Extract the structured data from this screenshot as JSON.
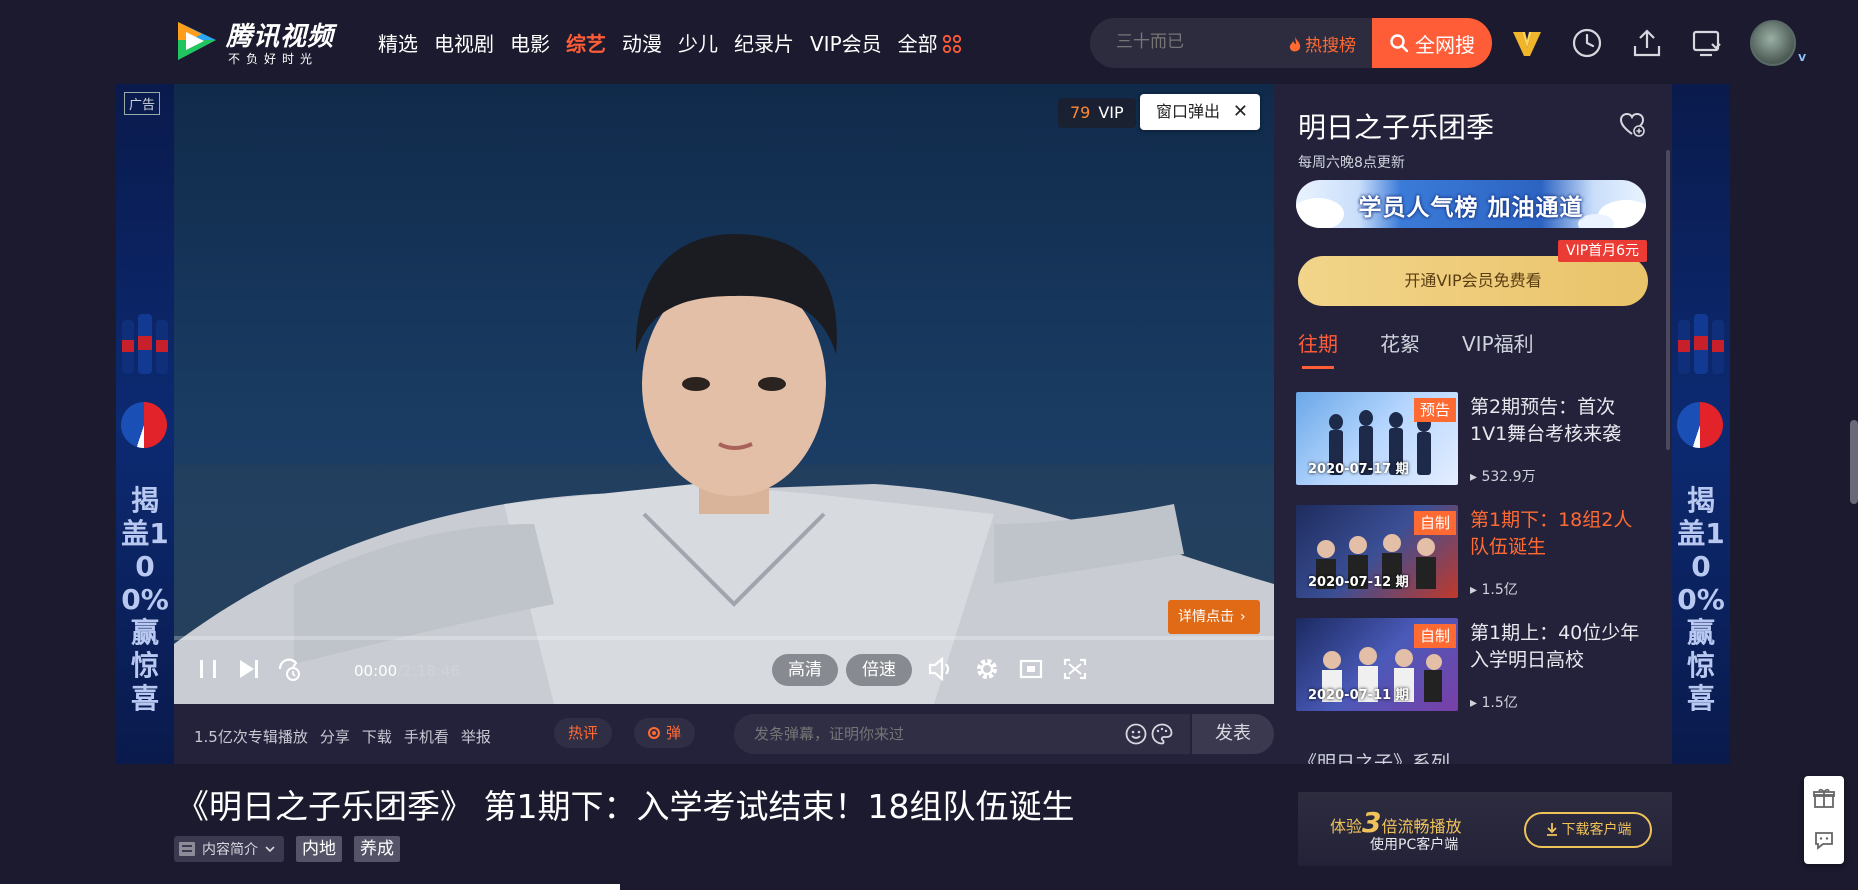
{
  "brand": {
    "name": "腾讯视频",
    "slogan": "不负好时光"
  },
  "nav": {
    "items": [
      {
        "label": "精选",
        "active": false
      },
      {
        "label": "电视剧",
        "active": false
      },
      {
        "label": "电影",
        "active": false
      },
      {
        "label": "综艺",
        "active": true
      },
      {
        "label": "动漫",
        "active": false
      },
      {
        "label": "少儿",
        "active": false
      },
      {
        "label": "纪录片",
        "active": false
      },
      {
        "label": "VIP会员",
        "active": false
      },
      {
        "label": "全部",
        "active": false
      }
    ]
  },
  "search": {
    "placeholder": "三十而已",
    "hot_rank_label": "热搜榜",
    "button_label": "全网搜"
  },
  "ad": {
    "tag": "广告",
    "slogan": "揭盖100%赢惊喜"
  },
  "player": {
    "vip_countdown": "79",
    "vip_label": "VIP",
    "popout_label": "窗口弹出",
    "detail_label": "详情点击",
    "current_time": "00:00",
    "total_time": "/2:18:46",
    "quality_label": "高清",
    "speed_label": "倍速",
    "progress": 0
  },
  "meta": {
    "play_count": "1.5亿次专辑播放",
    "share": "分享",
    "download": "下载",
    "mobile": "手机看",
    "report": "举报",
    "hot_comment": "热评",
    "danmu_label": "弹",
    "danmu_placeholder": "发条弹幕，证明你来过",
    "send_label": "发表"
  },
  "video": {
    "title": "《明日之子乐团季》 第1期下：入学考试结束！18组队伍诞生",
    "intro_label": "内容简介",
    "tags": [
      "内地",
      "养成"
    ]
  },
  "sidebar": {
    "title": "明日之子乐团季",
    "update_info": "每周六晚8点更新",
    "banner_text": "学员人气榜 加油通道",
    "vip_button": "开通VIP会员免费看",
    "vip_promo": "VIP首月6元",
    "tabs": [
      {
        "label": "往期",
        "active": true
      },
      {
        "label": "花絮",
        "active": false
      },
      {
        "label": "VIP福利",
        "active": false
      }
    ],
    "episodes": [
      {
        "title": "第2期预告：首次1V1舞台考核来袭",
        "date": "2020-07-17 期",
        "badge": "预告",
        "views": "532.9万",
        "current": false
      },
      {
        "title": "第1期下：18组2人队伍诞生",
        "date": "2020-07-12 期",
        "badge": "自制",
        "views": "1.5亿",
        "current": true
      },
      {
        "title": "第1期上：40位少年入学明日高校",
        "date": "2020-07-11 期",
        "badge": "自制",
        "views": "1.5亿",
        "current": false
      }
    ],
    "series_label": "《明日之子》系列"
  },
  "client_banner": {
    "prefix": "体验",
    "multiplier": "3",
    "suffix": "倍流畅播放",
    "line2": "使用PC客户端",
    "button": "下载客户端"
  },
  "colors": {
    "accent": "#ff5c38",
    "background": "#1b1a2e",
    "panel": "#23223a",
    "gold": "#f0c25a"
  }
}
